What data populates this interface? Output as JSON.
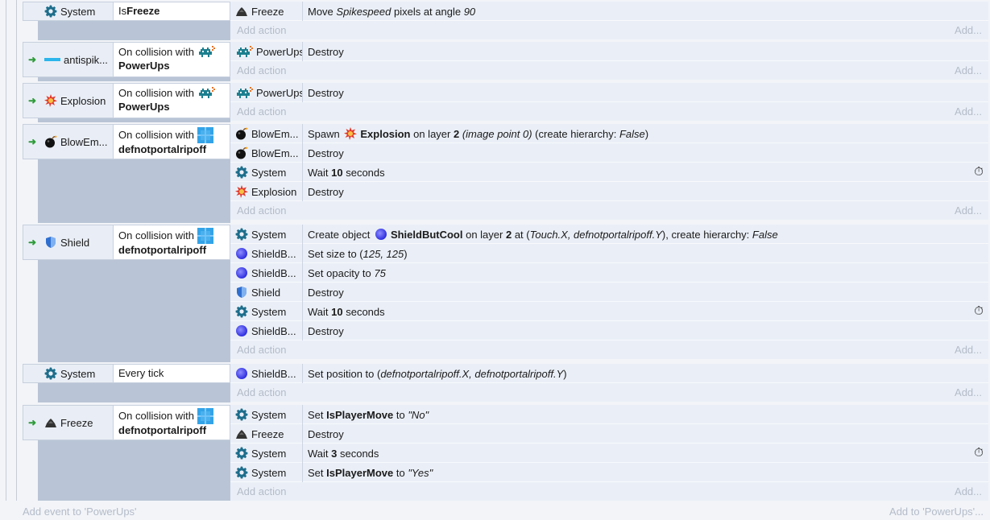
{
  "events": [
    {
      "trigger": false,
      "object": {
        "name": "System",
        "icon": "gear-icon"
      },
      "condition": {
        "pre": "Is ",
        "bold": "Freeze"
      },
      "actions": [
        {
          "object": "Freeze",
          "icon": "freeze-icon",
          "parts": [
            [
              "Move ",
              ""
            ],
            [
              "Spikespeed",
              "i"
            ],
            [
              " pixels at angle ",
              ""
            ],
            [
              "90",
              "i"
            ]
          ],
          "timer": false
        }
      ]
    },
    {
      "trigger": true,
      "object": {
        "name": "antispik...",
        "icon": "antispike-icon"
      },
      "condition": {
        "pre": "On collision with",
        "bold": "PowerUps",
        "icon": "powerups-icon"
      },
      "actions": [
        {
          "object": "PowerUps",
          "icon": "powerups-icon",
          "parts": [
            [
              "Destroy",
              ""
            ]
          ],
          "timer": false
        }
      ]
    },
    {
      "trigger": true,
      "object": {
        "name": "Explosion",
        "icon": "explosion-icon"
      },
      "condition": {
        "pre": "On collision with",
        "bold": "PowerUps",
        "icon": "powerups-icon"
      },
      "actions": [
        {
          "object": "PowerUps",
          "icon": "powerups-icon",
          "parts": [
            [
              "Destroy",
              ""
            ]
          ],
          "timer": false
        }
      ]
    },
    {
      "trigger": true,
      "object": {
        "name": "BlowEm...",
        "icon": "bomb-icon"
      },
      "condition": {
        "pre": "On collision with",
        "bold": "defnotportalripoff",
        "icon": "portal-icon"
      },
      "actions": [
        {
          "object": "BlowEm...",
          "icon": "bomb-icon",
          "parts": [
            [
              "Spawn ",
              ""
            ],
            [
              "@explosion",
              "icon"
            ],
            [
              "Explosion",
              "b"
            ],
            [
              " on layer ",
              ""
            ],
            [
              "2",
              "b"
            ],
            [
              " ",
              ""
            ],
            [
              "(image point 0)",
              "i"
            ],
            [
              " (create hierarchy: ",
              ""
            ],
            [
              "False",
              "i"
            ],
            [
              ")",
              ""
            ]
          ],
          "timer": false
        },
        {
          "object": "BlowEm...",
          "icon": "bomb-icon",
          "parts": [
            [
              "Destroy",
              ""
            ]
          ],
          "timer": false
        },
        {
          "object": "System",
          "icon": "gear-icon",
          "parts": [
            [
              "Wait ",
              ""
            ],
            [
              "10",
              "b"
            ],
            [
              " seconds",
              ""
            ]
          ],
          "timer": true
        },
        {
          "object": "Explosion",
          "icon": "explosion-icon",
          "parts": [
            [
              "Destroy",
              ""
            ]
          ],
          "timer": false
        }
      ]
    },
    {
      "trigger": true,
      "object": {
        "name": "Shield",
        "icon": "shield-icon"
      },
      "condition": {
        "pre": "On collision with",
        "bold": "defnotportalripoff",
        "icon": "portal-icon"
      },
      "actions": [
        {
          "object": "System",
          "icon": "gear-icon",
          "parts": [
            [
              "Create object ",
              ""
            ],
            [
              "@orb",
              "icon"
            ],
            [
              "ShieldButCool",
              "b"
            ],
            [
              " on layer ",
              ""
            ],
            [
              "2",
              "b"
            ],
            [
              " at (",
              ""
            ],
            [
              "Touch.X, defnotportalripoff.Y",
              "i"
            ],
            [
              "), create hierarchy: ",
              ""
            ],
            [
              "False",
              "i"
            ]
          ],
          "timer": false
        },
        {
          "object": "ShieldB...",
          "icon": "orb-icon",
          "parts": [
            [
              "Set size to (",
              ""
            ],
            [
              "125, 125",
              "i"
            ],
            [
              ")",
              ""
            ]
          ],
          "timer": false
        },
        {
          "object": "ShieldB...",
          "icon": "orb-icon",
          "parts": [
            [
              "Set opacity to ",
              ""
            ],
            [
              "75",
              "i"
            ]
          ],
          "timer": false
        },
        {
          "object": "Shield",
          "icon": "shield-icon",
          "parts": [
            [
              "Destroy",
              ""
            ]
          ],
          "timer": false
        },
        {
          "object": "System",
          "icon": "gear-icon",
          "parts": [
            [
              "Wait ",
              ""
            ],
            [
              "10",
              "b"
            ],
            [
              " seconds",
              ""
            ]
          ],
          "timer": true
        },
        {
          "object": "ShieldB...",
          "icon": "orb-icon",
          "parts": [
            [
              "Destroy",
              ""
            ]
          ],
          "timer": false
        }
      ]
    },
    {
      "trigger": false,
      "object": {
        "name": "System",
        "icon": "gear-icon"
      },
      "condition": {
        "pre": "Every tick",
        "bold": ""
      },
      "actions": [
        {
          "object": "ShieldB...",
          "icon": "orb-icon",
          "parts": [
            [
              "Set position to (",
              ""
            ],
            [
              "defnotportalripoff.X, defnotportalripoff.Y",
              "i"
            ],
            [
              ")",
              ""
            ]
          ],
          "timer": false
        }
      ]
    },
    {
      "trigger": true,
      "object": {
        "name": "Freeze",
        "icon": "freeze-icon"
      },
      "condition": {
        "pre": "On collision with",
        "bold": "defnotportalripoff",
        "icon": "portal-icon"
      },
      "actions": [
        {
          "object": "System",
          "icon": "gear-icon",
          "parts": [
            [
              "Set ",
              ""
            ],
            [
              "IsPlayerMove",
              "b"
            ],
            [
              " to ",
              ""
            ],
            [
              "\"No\"",
              "i"
            ]
          ],
          "timer": false
        },
        {
          "object": "Freeze",
          "icon": "freeze-icon",
          "parts": [
            [
              "Destroy",
              ""
            ]
          ],
          "timer": false
        },
        {
          "object": "System",
          "icon": "gear-icon",
          "parts": [
            [
              "Wait ",
              ""
            ],
            [
              "3",
              "b"
            ],
            [
              " seconds",
              ""
            ]
          ],
          "timer": true
        },
        {
          "object": "System",
          "icon": "gear-icon",
          "parts": [
            [
              "Set ",
              ""
            ],
            [
              "IsPlayerMove",
              "b"
            ],
            [
              " to ",
              ""
            ],
            [
              "\"Yes\"",
              "i"
            ]
          ],
          "timer": false
        }
      ]
    }
  ],
  "labels": {
    "add_action": "Add action",
    "add_action_short": "Add...",
    "add_event": "Add event to 'PowerUps'",
    "add_to": "Add to 'PowerUps'...",
    "trigger_arrow": "➜",
    "timer_glyph": "⏱"
  },
  "colors": {
    "accent_gear": "#1e6e8c",
    "trigger": "#2f9c3a",
    "event_bg": "#eaeff7",
    "indent_bg": "#b9c5d6"
  }
}
